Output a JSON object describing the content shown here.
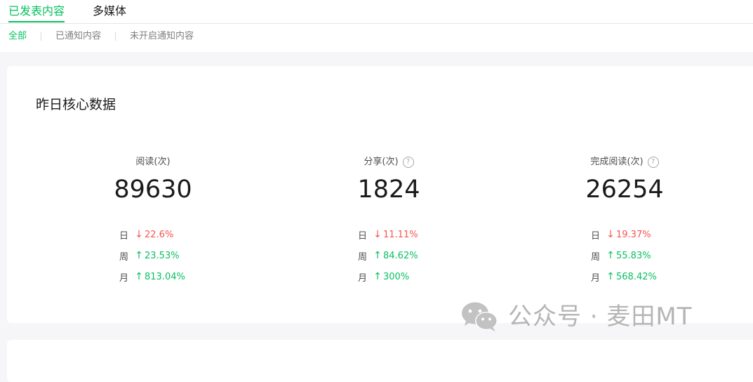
{
  "tabs": [
    {
      "label": "已发表内容",
      "active": true
    },
    {
      "label": "多媒体",
      "active": false
    }
  ],
  "subtabs": [
    {
      "label": "全部",
      "active": true
    },
    {
      "label": "已通知内容",
      "active": false
    },
    {
      "label": "未开启通知内容",
      "active": false
    }
  ],
  "card": {
    "title": "昨日核心数据",
    "metrics": [
      {
        "label": "阅读(次)",
        "has_help": false,
        "value": "89630",
        "changes": [
          {
            "period": "日",
            "direction": "down",
            "arrow": "↓",
            "value": "22.6%"
          },
          {
            "period": "周",
            "direction": "up",
            "arrow": "↑",
            "value": "23.53%"
          },
          {
            "period": "月",
            "direction": "up",
            "arrow": "↑",
            "value": "813.04%"
          }
        ]
      },
      {
        "label": "分享(次)",
        "has_help": true,
        "value": "1824",
        "changes": [
          {
            "period": "日",
            "direction": "down",
            "arrow": "↓",
            "value": "11.11%"
          },
          {
            "period": "周",
            "direction": "up",
            "arrow": "↑",
            "value": "84.62%"
          },
          {
            "period": "月",
            "direction": "up",
            "arrow": "↑",
            "value": "300%"
          }
        ]
      },
      {
        "label": "完成阅读(次)",
        "has_help": true,
        "value": "26254",
        "changes": [
          {
            "period": "日",
            "direction": "down",
            "arrow": "↓",
            "value": "19.37%"
          },
          {
            "period": "周",
            "direction": "up",
            "arrow": "↑",
            "value": "55.83%"
          },
          {
            "period": "月",
            "direction": "up",
            "arrow": "↑",
            "value": "568.42%"
          }
        ]
      }
    ]
  },
  "help_glyph": "?",
  "watermark": {
    "icon": "wechat-icon",
    "text": "公众号 · 麦田MT"
  },
  "colors": {
    "accent": "#07c160",
    "down": "#fa5151",
    "up": "#07c160"
  }
}
